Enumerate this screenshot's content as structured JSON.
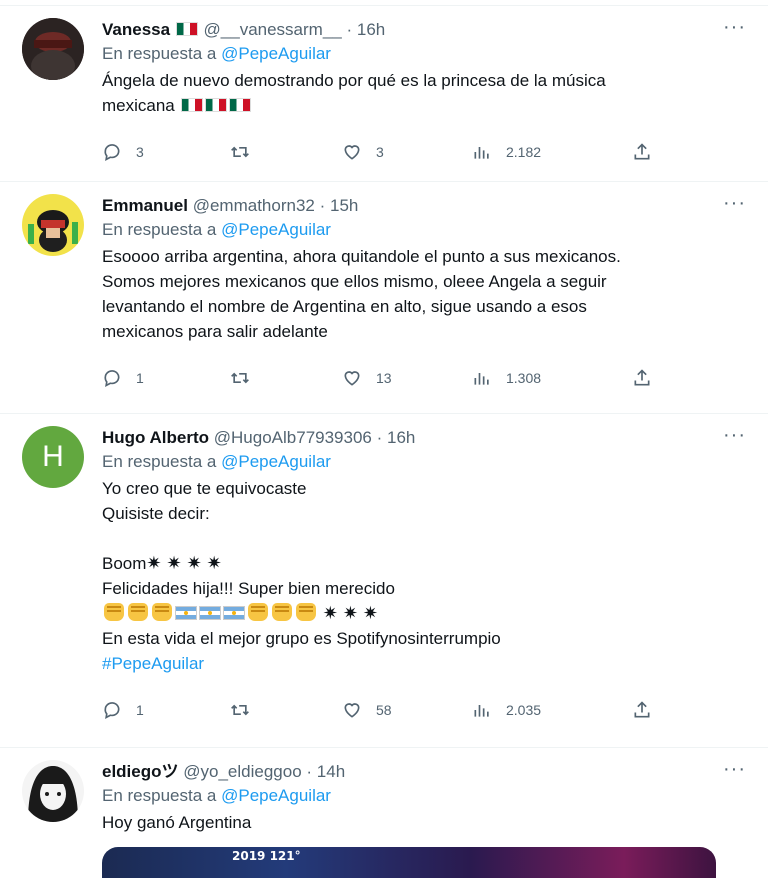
{
  "tweets": [
    {
      "name": "Vanessa",
      "handle": "@__vanessarm__",
      "time": "16h",
      "reply_prefix": "En respuesta a",
      "reply_to": "@PepeAguilar",
      "text_1": "Ángela de nuevo demostrando por qué es la princesa de la música",
      "text_2": "mexicana",
      "replies": "3",
      "retweets": "",
      "likes": "3",
      "views": "2.182"
    },
    {
      "name": "Emmanuel",
      "handle": "@emmathorn32",
      "time": "15h",
      "reply_prefix": "En respuesta a",
      "reply_to": "@PepeAguilar",
      "text_lines": [
        "Esoooo arriba argentina, ahora quitandole el punto a sus mexicanos.",
        "Somos mejores mexicanos que ellos mismo, oleee Angela a seguir",
        "levantando el nombre de Argentina en alto, sigue usando a esos",
        "mexicanos para salir adelante"
      ],
      "replies": "1",
      "retweets": "",
      "likes": "13",
      "views": "1.308"
    },
    {
      "name": "Hugo Alberto",
      "handle": "@HugoAlb77939306",
      "time": "16h",
      "avatar_letter": "H",
      "reply_prefix": "En respuesta a",
      "reply_to": "@PepeAguilar",
      "text_1": "Yo creo que te equivocaste",
      "text_2": "Quisiste decir:",
      "text_3": "Boom",
      "text_4": "Felicidades hija!!! Super bien merecido",
      "text_5": "En esta vida el mejor grupo es Spotifynosinterrumpio",
      "hashtag": "#PepeAguilar",
      "replies": "1",
      "retweets": "",
      "likes": "58",
      "views": "2.035"
    },
    {
      "name": "eldiego",
      "name_suffix": "ツ",
      "handle": "@yo_eldieggoo",
      "time": "14h",
      "reply_prefix": "En respuesta a",
      "reply_to": "@PepeAguilar",
      "text_1": "Hoy ganó Argentina",
      "media_text": "2019  121°"
    }
  ],
  "more_glyph": "···",
  "dot": "·",
  "colors": {
    "link": "#1d9bf0",
    "muted": "#536471",
    "text": "#0f1419",
    "hugo_avatar": "#62a83f"
  },
  "icons": [
    "reply-icon",
    "retweet-icon",
    "like-icon",
    "views-icon",
    "share-icon",
    "more-icon",
    "mexico-flag-icon",
    "argentina-flag-icon",
    "fist-icon",
    "star-icon"
  ]
}
